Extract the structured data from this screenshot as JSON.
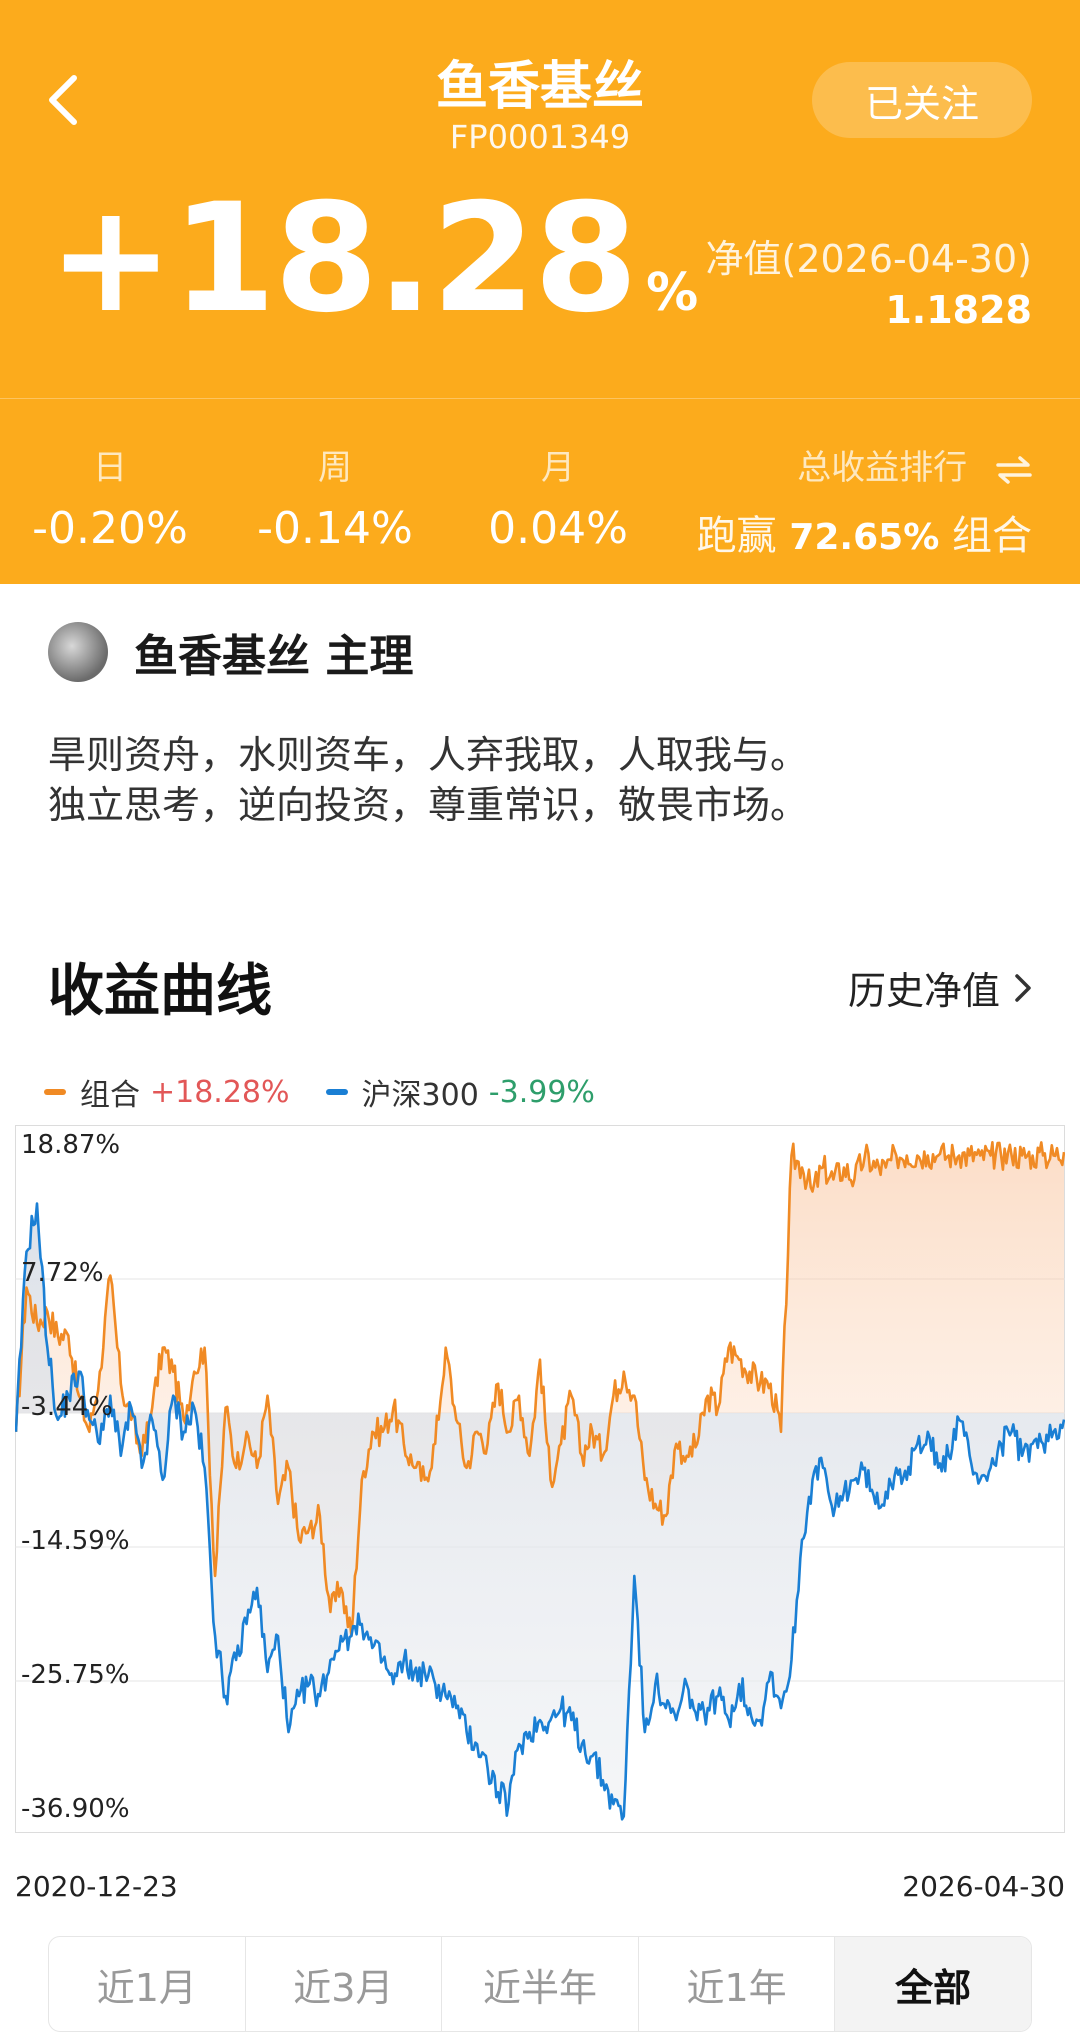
{
  "header": {
    "title": "鱼香基丝",
    "code": "FP0001349",
    "follow_label": "已关注",
    "total_return": "+18.28",
    "total_return_unit": "%",
    "nav_label": "净值(2026-04-30)",
    "nav_value": "1.1828",
    "stats": [
      {
        "label": "日",
        "value": "-0.20%"
      },
      {
        "label": "周",
        "value": "-0.14%"
      },
      {
        "label": "月",
        "value": "0.04%"
      }
    ],
    "rank": {
      "label": "总收益排行",
      "prefix": "跑赢",
      "value": "72.65%",
      "suffix": "组合"
    }
  },
  "manager": {
    "name": "鱼香基丝 主理",
    "motto_line1": "旱则资舟，水则资车，人弃我取，人取我与。",
    "motto_line2": "独立思考，逆向投资，尊重常识，敬畏市场。"
  },
  "section": {
    "title": "收益曲线",
    "history_label": "历史净值"
  },
  "legend": [
    {
      "name": "组合",
      "value": "+18.28%",
      "color": "#f08a24",
      "value_color": "#e25757"
    },
    {
      "name": "沪深300",
      "value": "-3.99%",
      "color": "#1a7fd4",
      "value_color": "#2e9e6b"
    }
  ],
  "chart_data": {
    "type": "line",
    "y_ticks": [
      "18.87%",
      "7.72%",
      "-3.44%",
      "-14.59%",
      "-25.75%",
      "-36.90%"
    ],
    "ylim": [
      -36.9,
      18.87
    ],
    "x_start": "2020-12-23",
    "x_end": "2026-04-30",
    "series": [
      {
        "name": "组合",
        "color": "#f08a24",
        "values": [
          -5,
          7,
          4,
          5,
          3,
          3,
          -2,
          -5,
          0,
          8,
          -1,
          -4,
          -7,
          -3,
          2,
          0,
          -4,
          0,
          2,
          -17,
          -3,
          -8,
          -5,
          -8,
          -2,
          -11,
          -8,
          -14,
          -13,
          -12,
          -20,
          -18,
          -22,
          -9,
          -5,
          -5,
          -3,
          -6,
          -8,
          -9,
          -6,
          2,
          -4,
          -8,
          -5,
          -6,
          -1,
          -5,
          -2,
          -7,
          1,
          -9,
          -6,
          -2,
          -7,
          -5,
          -7,
          -2,
          0,
          -2,
          -9,
          -11,
          -12,
          -6,
          -7,
          -6,
          -2,
          -3,
          2,
          1,
          0,
          -1,
          -1,
          -5,
          18,
          17,
          15,
          17,
          16,
          17,
          16,
          18,
          17,
          17,
          18,
          18,
          18,
          18,
          18,
          18,
          18,
          18,
          18,
          18,
          18,
          18,
          18,
          18,
          18,
          18,
          18.28
        ]
      },
      {
        "name": "沪深300",
        "color": "#1a7fd4",
        "values": [
          -5,
          10,
          14,
          2,
          -4,
          -2,
          0,
          -4,
          -6,
          -2,
          -7,
          -3,
          -8,
          -4,
          -9,
          -2,
          -5,
          -3,
          -8,
          -22,
          -27,
          -24,
          -21,
          -18,
          -25,
          -22,
          -30,
          -27,
          -26,
          -27,
          -24,
          -22,
          -22,
          -21,
          -23,
          -24,
          -26,
          -24,
          -25,
          -25,
          -26,
          -27,
          -28,
          -30,
          -31,
          -33,
          -35,
          -36,
          -31,
          -30,
          -29,
          -29,
          -28,
          -29,
          -31,
          -32,
          -34,
          -36,
          -37,
          -17,
          -30,
          -26,
          -28,
          -29,
          -26,
          -29,
          -28,
          -27,
          -29,
          -26,
          -28,
          -29,
          -25,
          -28,
          -24,
          -14,
          -9,
          -8,
          -12,
          -10,
          -9,
          -8,
          -11,
          -10,
          -8,
          -9,
          -6,
          -5,
          -8,
          -7,
          -4,
          -7,
          -9,
          -8,
          -6,
          -5,
          -7,
          -6,
          -6,
          -5,
          -3.99
        ]
      }
    ]
  },
  "ranges": [
    "近1月",
    "近3月",
    "近半年",
    "近1年",
    "全部"
  ],
  "active_range": "全部",
  "colors": {
    "brand": "#fcab1c"
  }
}
